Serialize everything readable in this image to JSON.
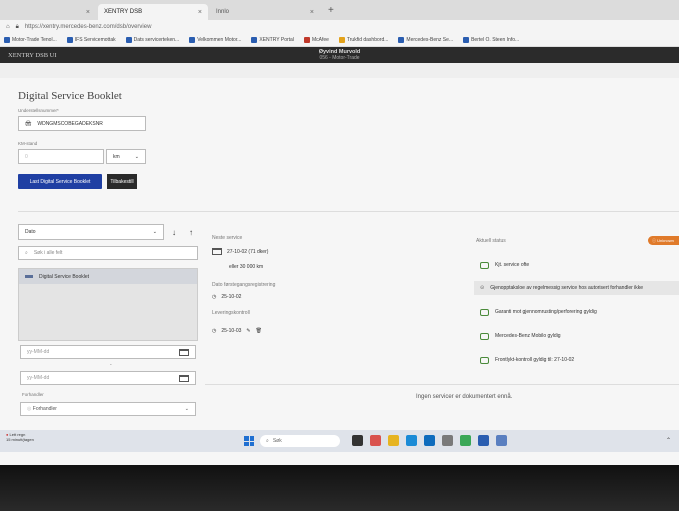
{
  "browser": {
    "tabs": [
      {
        "label": "",
        "close": "×"
      },
      {
        "label": "XENTRY DSB",
        "close": "×"
      },
      {
        "label": "Innlo",
        "close": "×"
      }
    ],
    "new_tab": "+",
    "url": "https://xentry.mercedes-benz.com/dsb/overview",
    "bookmarks": [
      "Motor-Trade Tenol...",
      "IFS Servicemottak",
      "Dats servicerteken...",
      "Velkommen Motor...",
      "XENTRY Portal",
      "McAfee",
      "Trukfid dashbord...",
      "Mercedes-Benz Se...",
      "Bertel O. Steen Info..."
    ]
  },
  "app": {
    "title": "XENTRY DSB UI",
    "user_name": "Øyvind Murvold",
    "user_org": "056 - Motor-Trade"
  },
  "page": {
    "title": "Digital Service Booklet",
    "vin_label": "Understellsnummer*",
    "vin_value": "WDNGMSCOBEGADEKSNR",
    "km_label": "KM-stand",
    "km_placeholder": "0",
    "km_unit": "km",
    "load_button": "Last Digital Service Booklet",
    "back_button": "Tilbakestill"
  },
  "filters": {
    "sort_value": "Dato",
    "search_placeholder": "Søk i alle felt",
    "list_items": [
      "Digital Service Booklet"
    ],
    "date_from_placeholder": "yy-MM-dd",
    "date_separator": "-",
    "date_to_placeholder": "yy-MM-dd",
    "dealer_label": "Forhandler",
    "dealer_value": "Forhandler"
  },
  "details": {
    "next_service_label": "Neste service",
    "next_service_date": "27-10-02 (71 dker)",
    "next_service_km": "eller 30 000 km",
    "reg_date_label": "Dato førstegangsregistrering",
    "reg_date": "25-10-02",
    "delivery_label": "Leveringskontroll",
    "delivery_date": "25-10-03"
  },
  "status": {
    "title": "Aktuell status",
    "badge": "Unknown",
    "items": [
      "Kjt. service ofte",
      "Gjenopptaksloe av regelmessig service hos autorisert forhandler ikke",
      "Garanti mot gjennomrusting/perforering gyldig",
      "Mercedes-Benz Mobilo gyldig",
      "Frontlykt-kontroll gyldig til: 27-10-02"
    ],
    "no_docs": "Ingen servicer er dokumentert ennå."
  },
  "taskbar": {
    "weather_temp": "Lett regn",
    "weather_sub": "15 minutt(tagen",
    "search_label": "Søk"
  },
  "colors": {
    "primary": "#1f3fa3",
    "header_bg": "#2b2b2b",
    "status_green": "#4a8a3a",
    "badge_orange": "#e07a2a"
  }
}
